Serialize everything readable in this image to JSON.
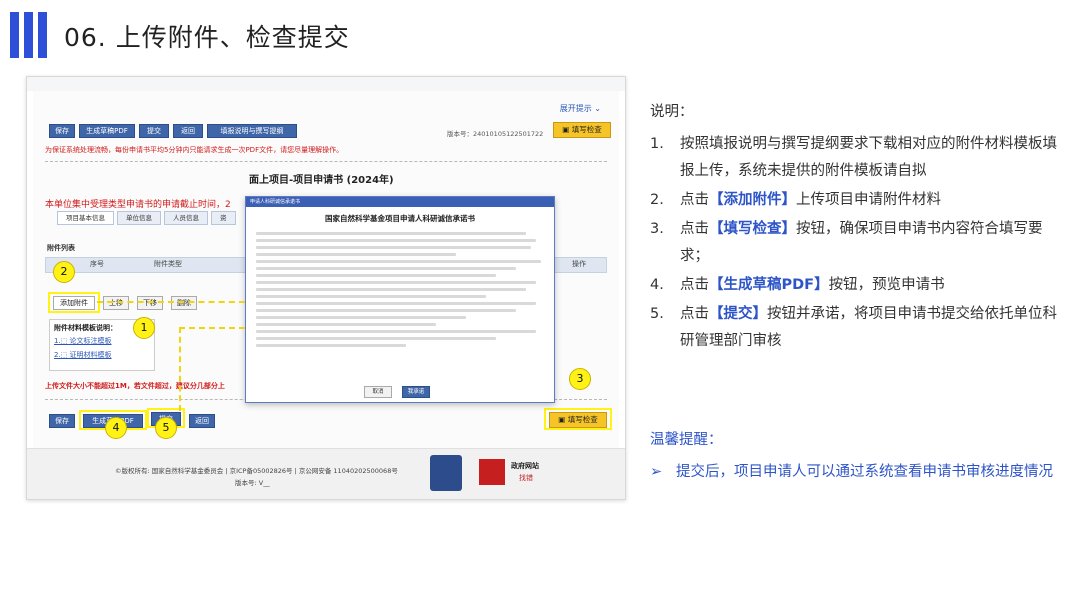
{
  "slide": {
    "title": "06. 上传附件、检查提交"
  },
  "screenshot": {
    "top_link": "展开提示",
    "toolbar": [
      "保存",
      "生成草稿PDF",
      "提交",
      "返回",
      "填报说明与撰写提纲"
    ],
    "version_label": "版本号：24010105122501722",
    "fill_check_label": "填写检查",
    "warning": "为保证系统处理流畅，每份申请书平均5分钟内只能请求生成一次PDF文件，请您尽量理解操作。",
    "form_title": "面上项目-项目申请书 (2024年)",
    "deadline_notice": "本单位集中受理类型申请书的申请截止时间，2",
    "tabs": [
      "项目基本信息",
      "单位信息",
      "人员信息",
      "资"
    ],
    "attachment_list_title": "附件列表",
    "grid_cols": [
      "序号",
      "附件类型",
      "操作"
    ],
    "row_buttons": [
      "添加附件",
      "上移",
      "下移",
      "删除"
    ],
    "template_title": "附件材料模板说明：",
    "templates": [
      "1.⬚ 论文标注模板",
      "2.⬚ 证明材料模板"
    ],
    "size_warning": "上传文件大小不能超过1M，若文件超过，建议分几部分上",
    "bottom_buttons": [
      "保存",
      "生成草稿PDF",
      "提交",
      "返回"
    ],
    "fill_check_bottom": "填写检查",
    "modal": {
      "header": "申请人科研诚信承诺书",
      "title": "国家自然科学基金项目申请人科研诚信承诺书",
      "cancel": "取消",
      "confirm": "我承诺"
    },
    "footer": {
      "copyright": "©版权所有: 国家自然科学基金委员会 | 京ICP备05002826号 | 京公网安备 11040202500068号",
      "version": "版本号: V__",
      "gov_label": "政府网站",
      "gov_sub": "找错"
    },
    "badges": [
      "1",
      "2",
      "3",
      "4",
      "5"
    ]
  },
  "panel": {
    "heading": "说明：",
    "steps": [
      {
        "num": "1.",
        "pre": "按照填报说明与撰写提纲要求下载相对应的附件材料模板填报上传，系统未提供的附件模板请自拟",
        "hl": "",
        "post": ""
      },
      {
        "num": "2.",
        "pre": "点击",
        "hl": "【添加附件】",
        "post": "上传项目申请附件材料"
      },
      {
        "num": "3.",
        "pre": "点击",
        "hl": "【填写检查】",
        "post": "按钮，确保项目申请书内容符合填写要求；"
      },
      {
        "num": "4.",
        "pre": "点击",
        "hl": "【生成草稿PDF】",
        "post": "按钮，预览申请书"
      },
      {
        "num": "5.",
        "pre": "点击",
        "hl": "【提交】",
        "post": "按钮并承诺，将项目申请书提交给依托单位科研管理部门审核"
      }
    ],
    "tips_heading": "温馨提醒：",
    "tips_arrow": "➢",
    "tips": [
      "提交后，项目申请人可以通过系统查看申请书审核进度情况"
    ]
  },
  "colors": {
    "accent": "#2e4fd8",
    "highlight": "#fff214",
    "link": "#2e55c8"
  }
}
